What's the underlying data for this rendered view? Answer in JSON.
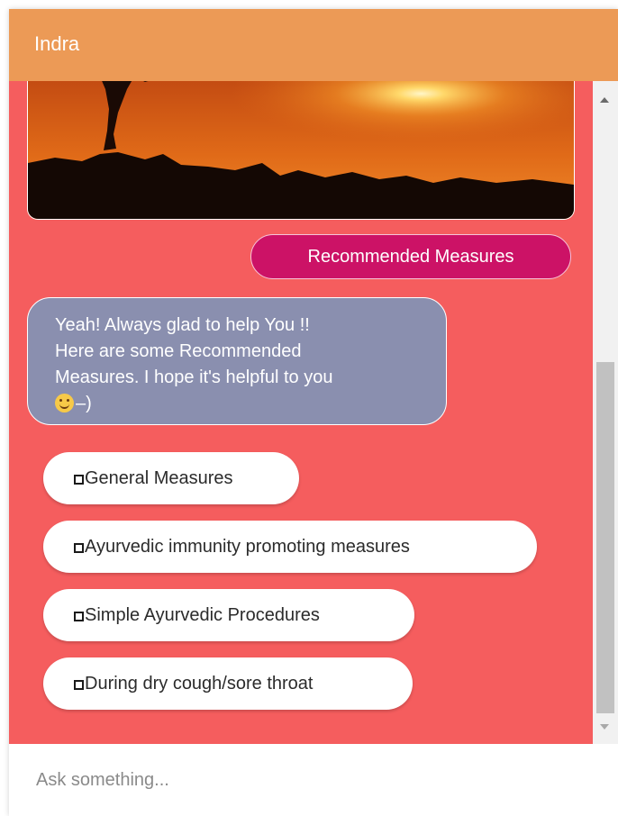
{
  "header": {
    "title": "Indra"
  },
  "messages": {
    "user": "Recommended Measures",
    "bot_lines": [
      "Yeah! Always glad to help You !!",
      "Here are some Recommended",
      "Measures. I hope it's helpful to you"
    ],
    "bot_tail": "–)"
  },
  "options": [
    "General Measures",
    "Ayurvedic immunity promoting measures",
    "Simple Ayurvedic Procedures",
    "During dry cough/sore throat"
  ],
  "input": {
    "placeholder": "Ask something..."
  },
  "icons": {
    "bullet": "square-bullet-icon",
    "emoji": "smiley-icon"
  },
  "colors": {
    "header": "#ec9a56",
    "chat_background": "#f55d5e",
    "user_bubble": "#cc1266",
    "bot_bubble": "#8a8faf"
  }
}
